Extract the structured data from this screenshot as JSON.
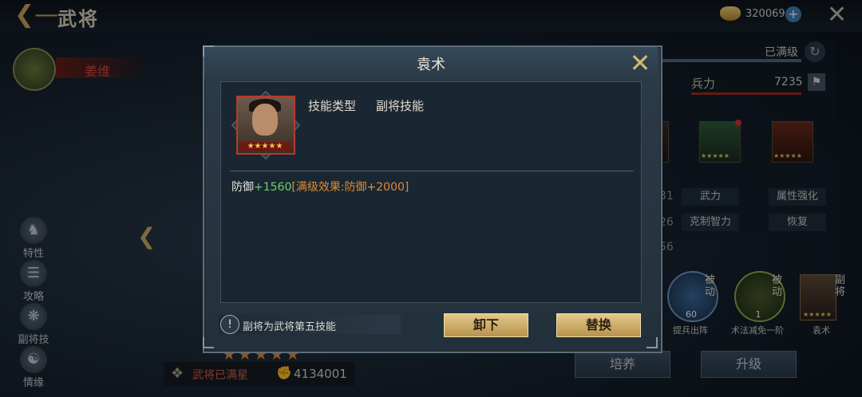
{
  "header": {
    "title": "武将",
    "gold_amount": "320069"
  },
  "general": {
    "name": "姜维",
    "max_star_label": "武将已满星",
    "power": "4134001",
    "stars": "★★★★★"
  },
  "sidebar": {
    "items": [
      {
        "label": "特性",
        "icon": "trait-icon"
      },
      {
        "label": "攻略",
        "icon": "guide-book-icon"
      },
      {
        "label": "副将技",
        "icon": "vice-skill-icon"
      },
      {
        "label": "情缘",
        "icon": "bond-icon"
      }
    ]
  },
  "right_panel": {
    "maxed_label": "已满级",
    "troops_label": "兵力",
    "troops_value": "7235",
    "equip_stars": "★★★★★",
    "attrs": [
      "武力",
      "属性强化",
      "克制智力",
      "恢复"
    ],
    "partial_numbers": [
      "31",
      "26",
      "56"
    ],
    "skills": [
      {
        "tag": "被动",
        "level": "60",
        "name": "提兵出阵"
      },
      {
        "tag": "被动",
        "level": "1",
        "name": "术法减免一阶"
      },
      {
        "tag": "副将",
        "name": "袁术",
        "stars": "★★★★★"
      }
    ],
    "buttons": {
      "cultivate": "培养",
      "upgrade": "升级"
    }
  },
  "modal": {
    "title": "袁术",
    "portrait_stars": "★★★★★",
    "skill_type_label": "技能类型",
    "skill_type_value": "副将技能",
    "effect_base": "防御",
    "effect_bonus": "+1560",
    "effect_max": "[满级效果:防御+2000]",
    "tip": "副将为武将第五技能",
    "unequip_label": "卸下",
    "replace_label": "替换"
  },
  "colors": {
    "accent_gold": "#d6b868",
    "effect_green": "#6ed06a",
    "effect_orange": "#e08a33",
    "name_red": "#d44a3a"
  }
}
